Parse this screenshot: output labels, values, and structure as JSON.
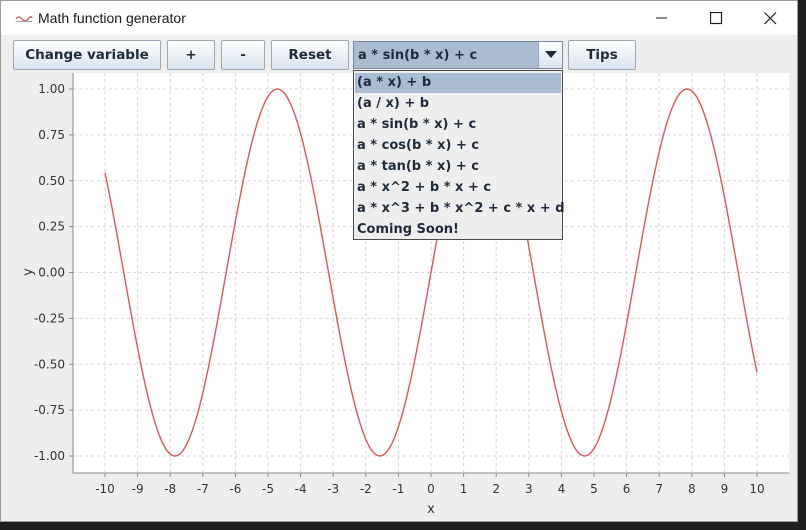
{
  "window": {
    "title": "Math function generator"
  },
  "toolbar": {
    "change_variable_label": "Change variable",
    "plus_label": "+",
    "minus_label": "-",
    "reset_label": "Reset",
    "tips_label": "Tips",
    "function_select": {
      "selected": "a * sin(b * x) + c",
      "options": [
        "(a * x) + b",
        "(a / x) + b",
        "a * sin(b * x) + c",
        "a * cos(b * x) + c",
        "a * tan(b * x) + c",
        "a * x^2 + b * x + c",
        "a * x^3 + b * x^2 + c * x + d",
        "Coming Soon!"
      ],
      "highlighted_option": "(a * x) + b"
    }
  },
  "colors": {
    "curve": "#e05555",
    "grid": "#d6d6d6",
    "selection": "#a9bcd2"
  },
  "chart_data": {
    "type": "line",
    "function": "a * sin(b * x) + c",
    "parameters": {
      "a": 1,
      "b": 1,
      "c": 0
    },
    "xlabel": "x",
    "ylabel": "y",
    "xlim": [
      -10,
      10
    ],
    "ylim": [
      -1,
      1
    ],
    "xticks": [
      "-10",
      "-9",
      "-8",
      "-7",
      "-6",
      "-5",
      "-4",
      "-3",
      "-2",
      "-1",
      "0",
      "1",
      "2",
      "3",
      "4",
      "5",
      "6",
      "7",
      "8",
      "9",
      "10"
    ],
    "yticks": [
      "1.00",
      "0.75",
      "0.50",
      "0.25",
      "0.00",
      "-0.25",
      "-0.50",
      "-0.75",
      "-1.00"
    ],
    "grid": true,
    "series": [
      {
        "x_range": [
          -10,
          10
        ],
        "samples": 401
      }
    ]
  }
}
